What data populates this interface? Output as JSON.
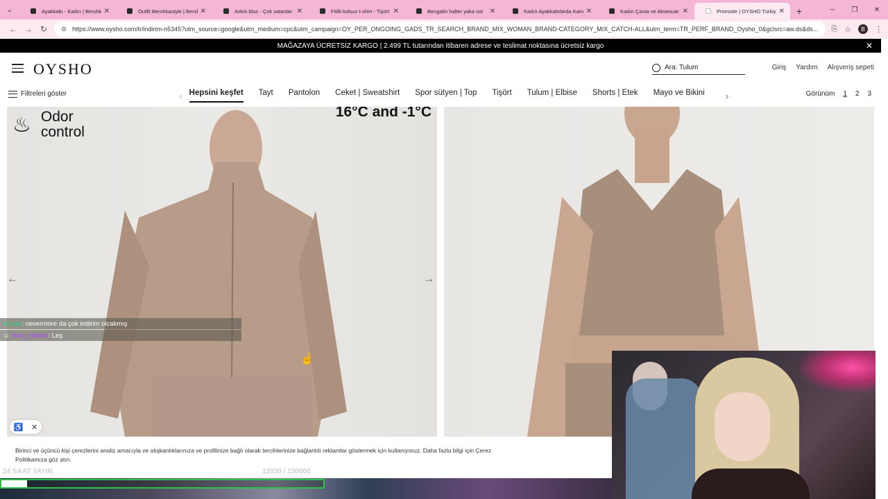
{
  "browser": {
    "tabs": [
      {
        "label": "Ayakkabı - Kadın | Bershka",
        "active": false,
        "favicon": "bershka"
      },
      {
        "label": "Outfit Bershkastyle | Bershka",
        "active": false,
        "favicon": "bershka"
      },
      {
        "label": "Askılı bluz - Çok satanlar",
        "active": false,
        "favicon": "bershka"
      },
      {
        "label": "Fitilli kolsuz t-shirt - Tişört",
        "active": false,
        "favicon": "bershka"
      },
      {
        "label": "Bengalin halter yaka üst",
        "active": false,
        "favicon": "bershka"
      },
      {
        "label": "Kadın Ayakkabılarda Kam",
        "active": false,
        "favicon": "bershka"
      },
      {
        "label": "Kadın Çanta ve Aksesuar",
        "active": false,
        "favicon": "bershka"
      },
      {
        "label": "Promotie | OYSHO Türkiye",
        "active": true,
        "favicon": "oysho"
      }
    ],
    "url": "https://www.oysho.com/tr/indirim-n5345?utm_source=google&utm_medium=cpc&utm_campaign=OY_PER_ONGOING_GADS_TR_SEARCH_BRAND_MIX_WOMAN_BRAND-CATEGORY_MIX_CATCH-ALL&utm_term=TR_PERF_BRAND_Oysho_0&gclsrc=aw.ds&ds...",
    "profile_initial": "B"
  },
  "promo": {
    "text": "MAĞAZAYA ÜCRETSİZ KARGO | 2.499 TL tutarından itibaren adrese ve teslimat noktasına ücretsiz kargo"
  },
  "header": {
    "logo": "OYSHO",
    "search_placeholder": "Ara: Tulum",
    "links": [
      "Giriş",
      "Yardım",
      "Alışveriş sepeti"
    ]
  },
  "catbar": {
    "filters_label": "Filtreleri göster",
    "categories": [
      {
        "label": "Hepsini keşfet",
        "active": true
      },
      {
        "label": "Tayt",
        "active": false
      },
      {
        "label": "Pantolon",
        "active": false
      },
      {
        "label": "Ceket | Sweatshirt",
        "active": false
      },
      {
        "label": "Spor sütyen | Top",
        "active": false
      },
      {
        "label": "Tişört",
        "active": false
      },
      {
        "label": "Tulum | Elbise",
        "active": false
      },
      {
        "label": "Shorts | Etek",
        "active": false
      },
      {
        "label": "Mayo ve Bikini",
        "active": false
      }
    ],
    "view_label": "Görünüm",
    "view_options": [
      "1",
      "2",
      "3"
    ]
  },
  "product_left": {
    "badge_line1": "Odor",
    "badge_line2": "control",
    "temp_text": "16°C and -1°C"
  },
  "chat": {
    "messages": [
      {
        "user": "ilomita",
        "text": ": nevermore da çok indirim olcakmış",
        "color": "#3bc97a"
      },
      {
        "user": "Ama_Hedon",
        "text": ": Leş",
        "color": "#b44cff"
      }
    ]
  },
  "cookie": {
    "text": "Birinci ve üçüncü kişi çerezlerini analiz amacıyla ve alışkanlıklarınıza ve profilinize bağlı olarak tercihlerinize bağlantılı reklamlar göstermek için kullanıyoruz. Daha fazla bilgi için Çerez Politikamıza göz atın."
  },
  "stream": {
    "label": "24 SAAT YAYIN",
    "count": "12030 / 150000",
    "progress_fraction": 0.08,
    "progress_color": "#2ec24a"
  },
  "colors": {
    "tabbar": "#f4b6d4",
    "addrbar": "#fde9f2",
    "promo_bg": "#000000"
  }
}
